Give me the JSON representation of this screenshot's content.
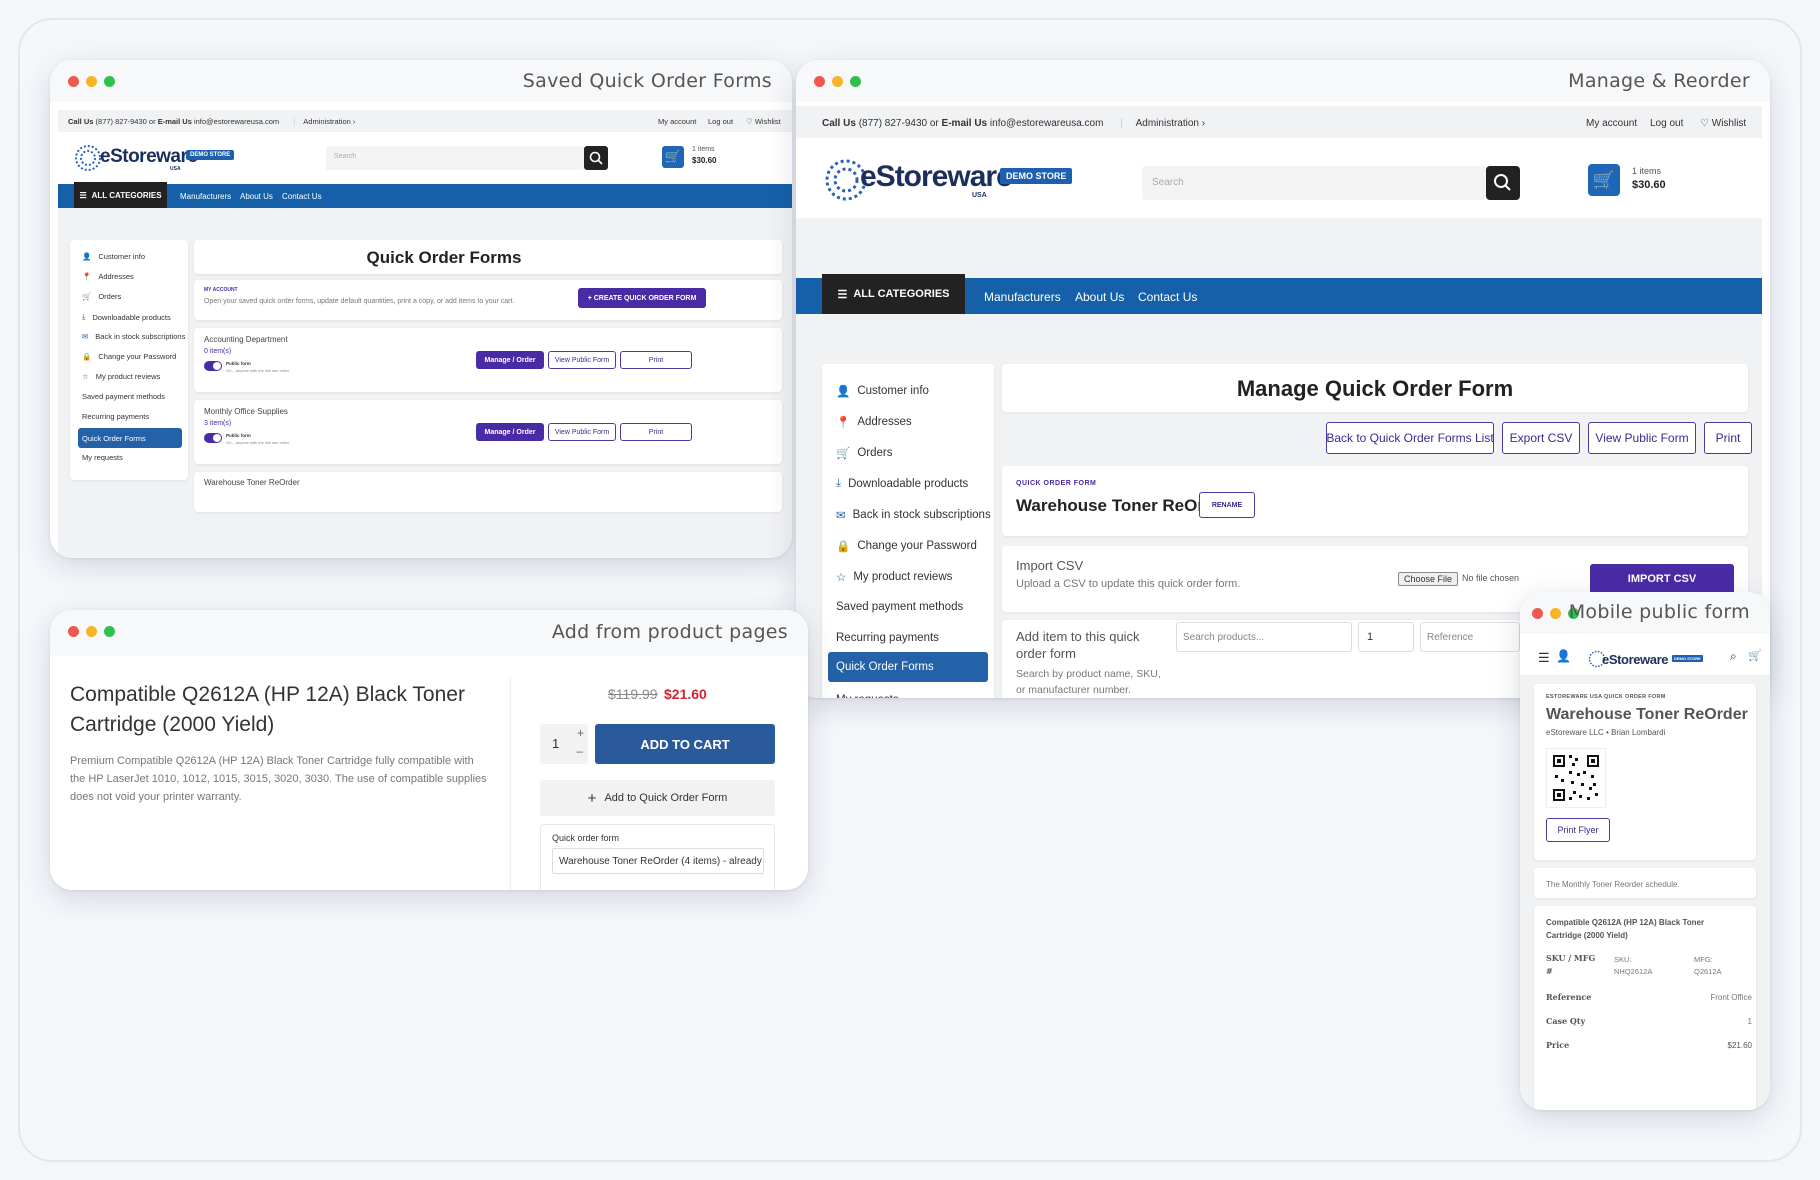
{
  "windows": {
    "saved": {
      "title": "Saved Quick Order Forms"
    },
    "manage": {
      "title": "Manage & Reorder"
    },
    "product": {
      "title": "Add from product pages"
    },
    "mobile": {
      "title": "Mobile public form"
    }
  },
  "topbar": {
    "call_label": "Call Us",
    "phone": "(877) 827-9430",
    "or": "or",
    "email_label": "E-mail Us",
    "email": "info@estorewareusa.com",
    "admin": "Administration",
    "my_account": "My account",
    "logout": "Log out",
    "wishlist": "Wishlist"
  },
  "brand": {
    "name": "eStoreware",
    "badge": "DEMO STORE",
    "sub": "USA"
  },
  "search": {
    "placeholder": "Search"
  },
  "cart": {
    "items": "1 items",
    "total": "$30.60"
  },
  "nav": {
    "all_categories": "ALL CATEGORIES",
    "links": [
      "Manufacturers",
      "About Us",
      "Contact Us"
    ]
  },
  "sidebar": {
    "items": [
      {
        "label": "Customer info",
        "icon": "user-icon"
      },
      {
        "label": "Addresses",
        "icon": "pin-icon"
      },
      {
        "label": "Orders",
        "icon": "cart-icon"
      },
      {
        "label": "Downloadable products",
        "icon": "download-icon"
      },
      {
        "label": "Back in stock subscriptions",
        "icon": "mail-icon"
      },
      {
        "label": "Change your Password",
        "icon": "lock-icon"
      },
      {
        "label": "My product reviews",
        "icon": "star-icon"
      },
      {
        "label": "Saved payment methods",
        "icon": ""
      },
      {
        "label": "Recurring payments",
        "icon": ""
      },
      {
        "label": "Quick Order Forms",
        "icon": "",
        "selected": true
      },
      {
        "label": "My requests",
        "icon": ""
      }
    ]
  },
  "saved_page": {
    "title": "Quick Order Forms",
    "my_account_label": "MY ACCOUNT",
    "intro": "Open your saved quick order forms, update default quantities, print a copy, or add items to your cart.",
    "create_button": "+ CREATE QUICK ORDER FORM",
    "forms": [
      {
        "name": "Accounting Department",
        "count": "0 item(s)",
        "public_label": "Public form",
        "public_note": "On – anyone with the link can order",
        "public": true
      },
      {
        "name": "Monthly Office Supplies",
        "count": "3 item(s)",
        "public_label": "Public form",
        "public_note": "On – anyone with the link can order",
        "public": true
      },
      {
        "name": "Warehouse Toner ReOrder"
      }
    ],
    "manage_label": "Manage / Order",
    "view_label": "View Public Form",
    "print_label": "Print"
  },
  "manage_page": {
    "title": "Manage Quick Order Form",
    "buttons": [
      "Back to Quick Order Forms List",
      "Export CSV",
      "View Public Form",
      "Print"
    ],
    "section_label": "QUICK ORDER FORM",
    "form_name": "Warehouse Toner ReOrder",
    "rename": "RENAME",
    "import_title": "Import CSV",
    "import_desc": "Upload a CSV to update this quick order form.",
    "choose_file": "Choose File",
    "no_file": "No file chosen",
    "import_button": "IMPORT CSV",
    "add_title": "Add item to this quick order form",
    "add_desc": "Search by product name, SKU, or manufacturer number.",
    "search_placeholder": "Search products...",
    "qty_value": "1",
    "ref_placeholder": "Reference"
  },
  "product_page": {
    "title": "Compatible Q2612A (HP 12A) Black Toner Cartridge (2000 Yield)",
    "desc": "Premium Compatible Q2612A (HP 12A) Black Toner Cartridge fully compatible with the HP LaserJet 1010, 1012, 1015, 3015, 3020, 3030. The use of compatible supplies does not void your printer warranty.",
    "old_price": "$119.99",
    "price": "$21.60",
    "qty": "1",
    "add_to_cart": "ADD TO CART",
    "add_quick": "Add to Quick Order Form",
    "qof_label": "Quick order form",
    "qof_value": "Warehouse Toner ReOrder (4 items) - already"
  },
  "mobile_page": {
    "eyebrow": "ESTOREWARE USA QUICK ORDER FORM",
    "title": "Warehouse Toner ReOrder",
    "company": "eStoreware LLC",
    "person": "Brian Lombardi",
    "print_flyer": "Print Flyer",
    "note": "The Monthly Toner Reorder schedule.",
    "item_title": "Compatible Q2612A (HP 12A) Black Toner Cartridge (2000 Yield)",
    "sku_label": "SKU / MFG #",
    "sku": "SKU: NHQ2612A",
    "mfg": "MFG: Q2612A",
    "ref_label": "Reference",
    "ref_value": "Front Office",
    "case_label": "Case Qty",
    "case_value": "1",
    "price_label": "Price",
    "price_value": "$21.60"
  },
  "colors": {
    "primary_purple": "#4a2ba6",
    "nav_blue": "#1560a8",
    "dark": "#222",
    "sale_red": "#d0262b"
  }
}
